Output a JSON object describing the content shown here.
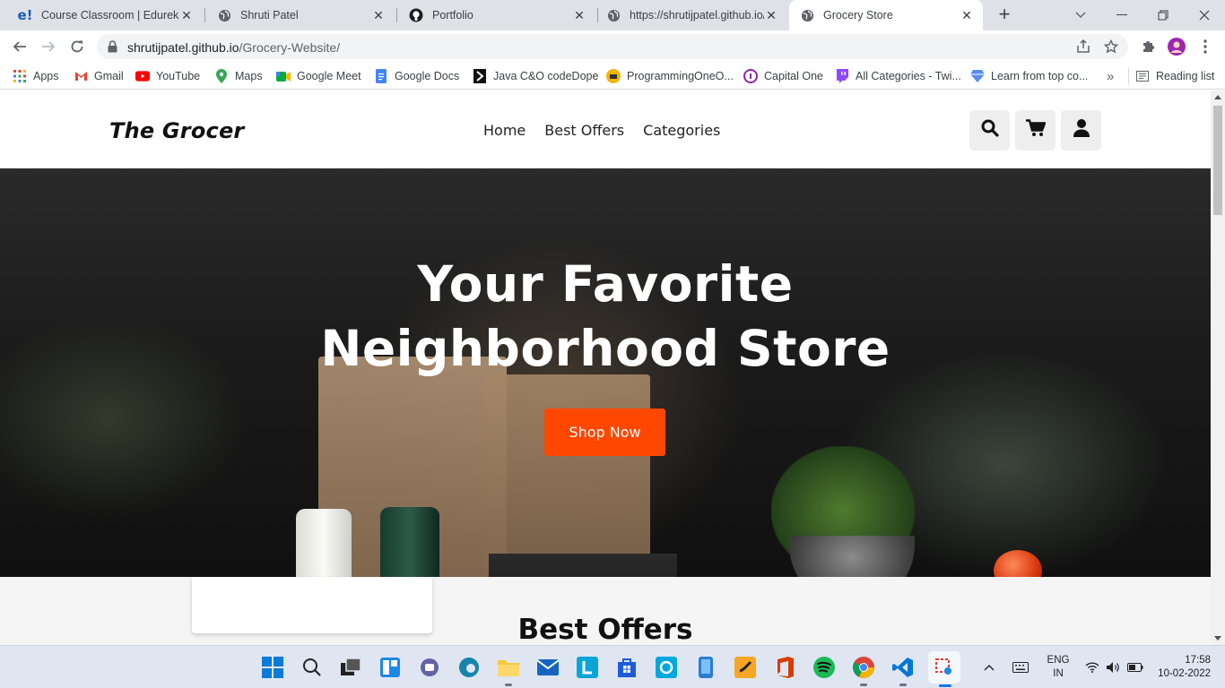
{
  "browser": {
    "tabs": [
      {
        "title": "Course Classroom | Edureka",
        "icon": "edureka-icon",
        "active": false
      },
      {
        "title": "Shruti Patel",
        "icon": "globe-icon",
        "active": false
      },
      {
        "title": "Portfolio",
        "icon": "github-icon",
        "active": false
      },
      {
        "title": "https://shrutijpatel.github.io/",
        "icon": "globe-icon",
        "active": false
      },
      {
        "title": "Grocery Store",
        "icon": "globe-icon",
        "active": true
      }
    ],
    "edureka_badge": "e!",
    "url_host": "shrutijpatel.github.io",
    "url_path": "/Grocery-Website/",
    "bookmarks": [
      {
        "label": "Apps",
        "icon": "apps-grid-icon"
      },
      {
        "label": "Gmail",
        "icon": "gmail-icon"
      },
      {
        "label": "YouTube",
        "icon": "youtube-icon"
      },
      {
        "label": "Maps",
        "icon": "maps-icon"
      },
      {
        "label": "Google Meet",
        "icon": "meet-icon"
      },
      {
        "label": "Google Docs",
        "icon": "docs-icon"
      },
      {
        "label": "Java C&O codeDope",
        "icon": "codedope-icon"
      },
      {
        "label": "ProgrammingOneO...",
        "icon": "programming-icon"
      },
      {
        "label": "Capital One",
        "icon": "capital-one-icon"
      },
      {
        "label": "All Categories - Twi...",
        "icon": "twitch-icon"
      },
      {
        "label": "Learn from top co...",
        "icon": "learn-icon"
      }
    ],
    "reading_list": "Reading list",
    "overflow": "»"
  },
  "site": {
    "logo": "The Grocer",
    "nav": [
      "Home",
      "Best Offers",
      "Categories"
    ],
    "hero_line1": "Your Favorite",
    "hero_line2": "Neighborhood Store",
    "cta": "Shop Now",
    "section_title": "Best Offers"
  },
  "taskbar": {
    "lang_line1": "ENG",
    "lang_line2": "IN",
    "time": "17:58",
    "date": "10-02-2022"
  },
  "colors": {
    "cta": "#ff4700",
    "tabstrip": "#dee1e6",
    "taskbar": "#dfe6f2"
  }
}
